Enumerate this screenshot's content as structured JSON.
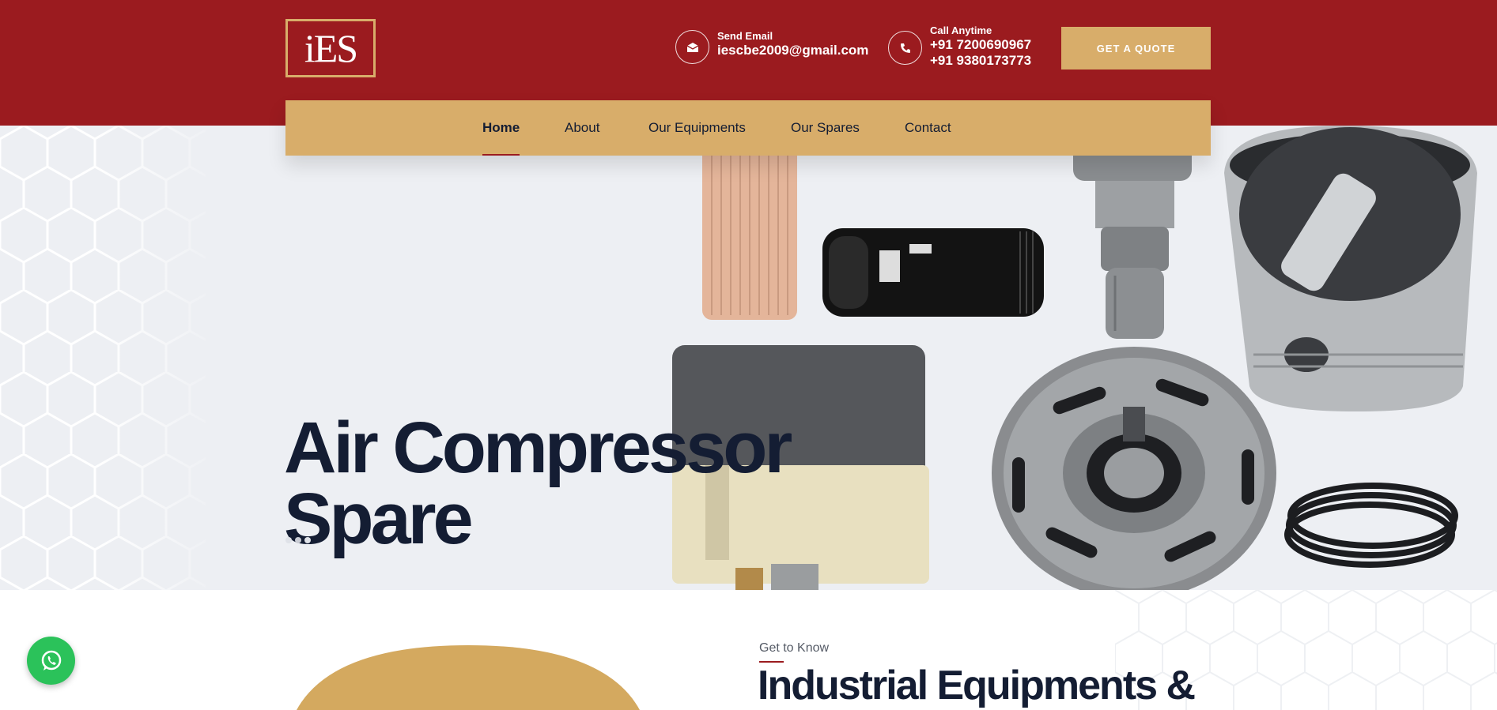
{
  "header": {
    "logo_text": "iES",
    "email": {
      "label": "Send Email",
      "value": "iescbe2009@gmail.com",
      "icon": "envelope-icon"
    },
    "phone": {
      "label": "Call Anytime",
      "value1": "+91 7200690967",
      "value2": "+91 9380173773",
      "icon": "phone-icon"
    },
    "quote_button": "GET A QUOTE"
  },
  "nav": {
    "items": [
      {
        "label": "Home",
        "active": true
      },
      {
        "label": "About"
      },
      {
        "label": "Our Equipments"
      },
      {
        "label": "Our Spares"
      },
      {
        "label": "Contact"
      }
    ]
  },
  "hero": {
    "title_line1": "Air Compressor",
    "title_line2": "Spare",
    "slides": 3,
    "active_slide": 2
  },
  "about": {
    "subtitle": "Get to Know",
    "title": "Industrial Equipments &"
  },
  "colors": {
    "primary_red": "#9b1b1f",
    "gold": "#d8ad6a",
    "navy": "#141d33",
    "whatsapp_green": "#2bc25a"
  },
  "floating": {
    "whatsapp_icon": "whatsapp-icon"
  }
}
